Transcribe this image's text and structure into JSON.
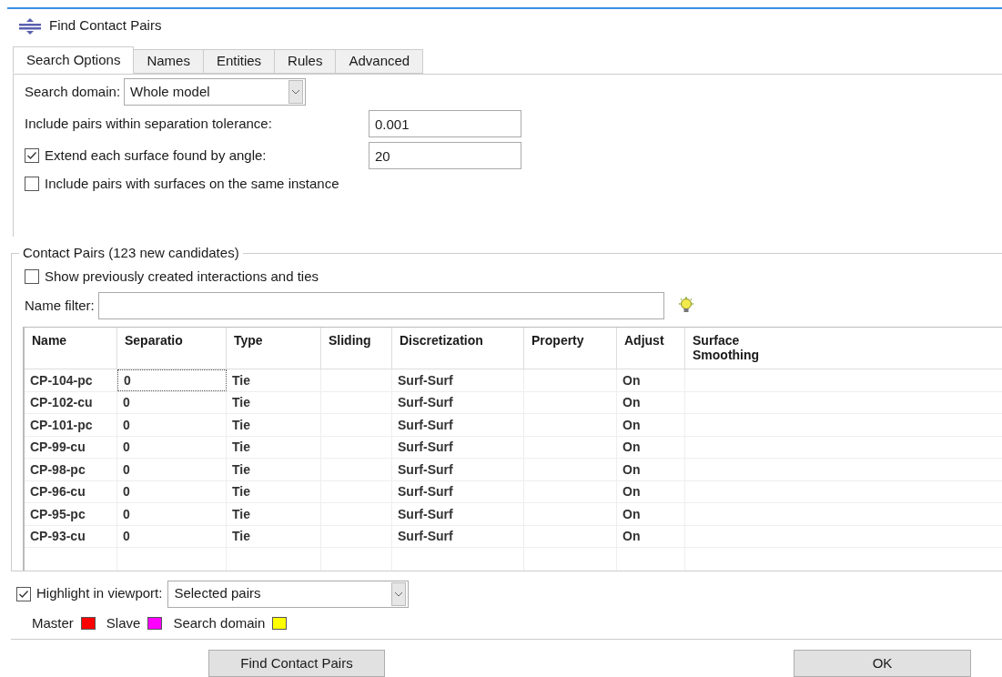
{
  "window": {
    "title": "Find Contact Pairs"
  },
  "tabs": [
    {
      "label": "Search Options",
      "selected": true
    },
    {
      "label": "Names",
      "selected": false
    },
    {
      "label": "Entities",
      "selected": false
    },
    {
      "label": "Rules",
      "selected": false
    },
    {
      "label": "Advanced",
      "selected": false
    }
  ],
  "search_options": {
    "search_domain": {
      "label": "Search domain:",
      "value": "Whole model"
    },
    "tolerance": {
      "label": "Include pairs within separation tolerance:",
      "value": "0.001"
    },
    "extend": {
      "label": "Extend each surface found by angle:",
      "checked": true,
      "value": "20"
    },
    "same_instance": {
      "label": "Include pairs with surfaces on the same instance",
      "checked": false
    }
  },
  "contact_pairs": {
    "title": "Contact Pairs (123 new candidates)",
    "show_previous": {
      "label": "Show previously created interactions and ties",
      "checked": false
    },
    "name_filter": {
      "label": "Name filter:"
    },
    "table": {
      "columns": [
        "Name",
        "Separatio",
        "Type",
        "Sliding",
        "Discretization",
        "Property",
        "Adjust",
        "Surface Smoothing"
      ],
      "rows": [
        {
          "cells": [
            "CP-104-pc",
            "0",
            "Tie",
            "",
            "Surf-Surf",
            "",
            "On",
            ""
          ],
          "focused": true
        },
        {
          "cells": [
            "CP-102-cu",
            "0",
            "Tie",
            "",
            "Surf-Surf",
            "",
            "On",
            ""
          ],
          "focused": false
        },
        {
          "cells": [
            "CP-101-pc",
            "0",
            "Tie",
            "",
            "Surf-Surf",
            "",
            "On",
            ""
          ],
          "focused": false
        },
        {
          "cells": [
            "CP-99-cu",
            "0",
            "Tie",
            "",
            "Surf-Surf",
            "",
            "On",
            ""
          ],
          "focused": false
        },
        {
          "cells": [
            "CP-98-pc",
            "0",
            "Tie",
            "",
            "Surf-Surf",
            "",
            "On",
            ""
          ],
          "focused": false
        },
        {
          "cells": [
            "CP-96-cu",
            "0",
            "Tie",
            "",
            "Surf-Surf",
            "",
            "On",
            ""
          ],
          "focused": false
        },
        {
          "cells": [
            "CP-95-pc",
            "0",
            "Tie",
            "",
            "Surf-Surf",
            "",
            "On",
            ""
          ],
          "focused": false
        },
        {
          "cells": [
            "CP-93-cu",
            "0",
            "Tie",
            "",
            "Surf-Surf",
            "",
            "On",
            ""
          ],
          "focused": false
        }
      ]
    }
  },
  "highlight": {
    "label": "Highlight in viewport:",
    "checked": true,
    "value": "Selected pairs"
  },
  "legend": [
    {
      "label": "Master",
      "color": "#ff0000"
    },
    {
      "label": "Slave",
      "color": "#ff00ff"
    },
    {
      "label": "Search domain",
      "color": "#ffff00"
    }
  ],
  "buttons": [
    {
      "label": "Find Contact Pairs",
      "kind": "action"
    },
    {
      "label": "OK",
      "kind": "ok"
    }
  ]
}
